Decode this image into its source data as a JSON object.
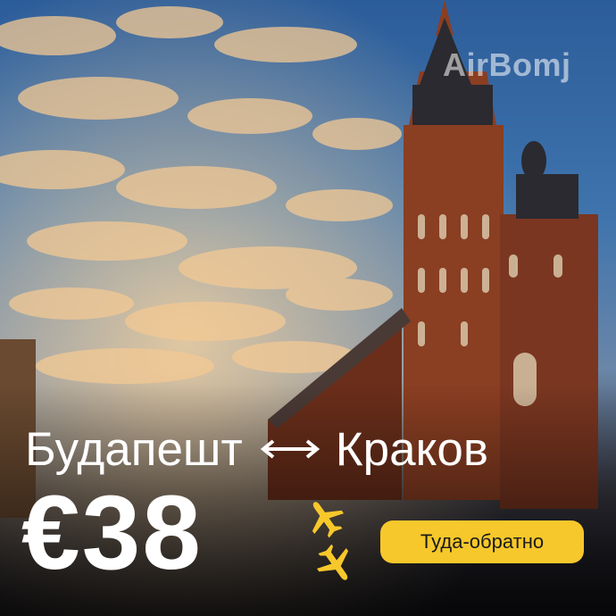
{
  "brand": "AirBomj",
  "route": {
    "from": "Будапешт",
    "to": "Краков"
  },
  "price": "€38",
  "trip_type": "Туда-обратно",
  "icons": {
    "arrow": "double-arrow-icon",
    "plane": "airplane-icon"
  },
  "colors": {
    "badge": "#f7c82b",
    "plane": "#f7c82b",
    "text": "#ffffff"
  }
}
